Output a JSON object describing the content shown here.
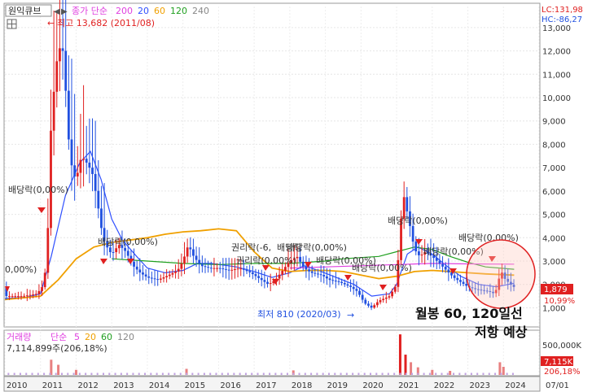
{
  "header": {
    "stock_name": "원익큐브",
    "legend_prefix": "종가 단순",
    "ma_periods": [
      "200",
      "20",
      "60",
      "120",
      "240"
    ],
    "ma_colors": [
      "#e040e0",
      "#3050ff",
      "#f0a000",
      "#20a020",
      "#888888"
    ],
    "lc": "LC:131,98",
    "hc": "HC:-86,27"
  },
  "annotations": {
    "high_label": "최고 13,682 (2011/08)",
    "low_label": "최저 810 (2020/03)",
    "dividend": "배당락(0,00%)",
    "dividend_trunc": "배당락",
    "rights": "권리락(-6,",
    "rights_combo": "권리락(0,00%)",
    "edge_pct": "0,00%)",
    "price_tag": "1,879",
    "pct_tag": "10,99%",
    "note_line1": "월봉 60, 120일선",
    "note_line2": "저항 예상"
  },
  "volume_panel": {
    "legend_prefix": "거래량",
    "legend_ma": "단순",
    "periods": [
      "5",
      "20",
      "60",
      "120"
    ],
    "period_colors": [
      "#e040e0",
      "#f0a000",
      "#20a020",
      "#888888"
    ],
    "summary": "7,114,899주(206,18%)",
    "axis_top": "500,000K",
    "vol_tag": "7,115K",
    "vol_pct": "206,18%"
  },
  "x_labels": [
    "2010",
    "2011",
    "2012",
    "2013",
    "2014",
    "2015",
    "2016",
    "2017",
    "2018",
    "2019",
    "2020",
    "2021",
    "2022",
    "2023",
    "2024",
    "07/01"
  ],
  "chart_data": {
    "type": "candlestick",
    "interval": "monthly",
    "y_ticks": [
      1000,
      2000,
      3000,
      4000,
      5000,
      6000,
      7000,
      8000,
      9000,
      10000,
      11000,
      12000,
      13000
    ],
    "y_tick_labels": [
      "1,000",
      "2,000",
      "3,000",
      "4,000",
      "5,000",
      "6,000",
      "7,000",
      "8,000",
      "9,000",
      "10,000",
      "11,000",
      "12,000",
      "13,000"
    ],
    "ylim": [
      250,
      13900
    ],
    "x_range": [
      2010.0,
      2025.0
    ],
    "points": [
      [
        2010.0,
        1500
      ],
      [
        2010.5,
        1500
      ],
      [
        2010.9,
        1600
      ],
      [
        2011.1,
        2000
      ],
      [
        2011.2,
        4000
      ],
      [
        2011.3,
        9000
      ],
      [
        2011.45,
        11500
      ],
      [
        2011.6,
        12500
      ],
      [
        2011.7,
        10500
      ],
      [
        2011.8,
        8000
      ],
      [
        2011.9,
        6800
      ],
      [
        2012.0,
        6500
      ],
      [
        2012.15,
        7500
      ],
      [
        2012.3,
        7200
      ],
      [
        2012.45,
        6800
      ],
      [
        2012.6,
        5500
      ],
      [
        2012.75,
        4000
      ],
      [
        2012.9,
        3500
      ],
      [
        2013.0,
        3300
      ],
      [
        2013.2,
        3700
      ],
      [
        2013.4,
        3400
      ],
      [
        2013.6,
        2800
      ],
      [
        2013.8,
        2500
      ],
      [
        2014.0,
        2300
      ],
      [
        2014.3,
        2200
      ],
      [
        2014.6,
        2400
      ],
      [
        2014.85,
        2600
      ],
      [
        2015.0,
        3000
      ],
      [
        2015.15,
        3700
      ],
      [
        2015.3,
        3200
      ],
      [
        2015.5,
        2800
      ],
      [
        2015.75,
        2700
      ],
      [
        2016.0,
        2700
      ],
      [
        2016.3,
        2600
      ],
      [
        2016.6,
        2700
      ],
      [
        2016.9,
        2500
      ],
      [
        2017.1,
        2300
      ],
      [
        2017.4,
        2000
      ],
      [
        2017.6,
        2200
      ],
      [
        2017.8,
        2600
      ],
      [
        2018.0,
        3000
      ],
      [
        2018.2,
        3200
      ],
      [
        2018.4,
        2700
      ],
      [
        2018.6,
        2500
      ],
      [
        2018.9,
        2400
      ],
      [
        2019.1,
        2200
      ],
      [
        2019.4,
        2100
      ],
      [
        2019.7,
        1900
      ],
      [
        2019.9,
        1700
      ],
      [
        2020.1,
        1200
      ],
      [
        2020.3,
        1000
      ],
      [
        2020.5,
        1300
      ],
      [
        2020.8,
        1500
      ],
      [
        2021.0,
        2000
      ],
      [
        2021.1,
        4500
      ],
      [
        2021.2,
        5800
      ],
      [
        2021.35,
        4700
      ],
      [
        2021.5,
        3500
      ],
      [
        2021.65,
        3200
      ],
      [
        2021.8,
        3400
      ],
      [
        2022.0,
        3200
      ],
      [
        2022.2,
        2900
      ],
      [
        2022.4,
        2600
      ],
      [
        2022.6,
        2300
      ],
      [
        2022.8,
        2100
      ],
      [
        2023.0,
        1900
      ],
      [
        2023.2,
        1800
      ],
      [
        2023.4,
        1750
      ],
      [
        2023.6,
        1700
      ],
      [
        2023.75,
        1600
      ],
      [
        2023.85,
        2000
      ],
      [
        2023.92,
        2700
      ],
      [
        2024.0,
        2300
      ],
      [
        2024.2,
        2000
      ],
      [
        2024.3,
        1879
      ]
    ],
    "moving_averages": [
      {
        "name": "20",
        "color": "#3050ff",
        "values": [
          [
            2010.0,
            1400
          ],
          [
            2010.6,
            1450
          ],
          [
            2011.0,
            1600
          ],
          [
            2011.3,
            3200
          ],
          [
            2011.7,
            5800
          ],
          [
            2012.1,
            7200
          ],
          [
            2012.4,
            7700
          ],
          [
            2012.7,
            6500
          ],
          [
            2013.0,
            4800
          ],
          [
            2013.3,
            3900
          ],
          [
            2013.7,
            3200
          ],
          [
            2014.0,
            2700
          ],
          [
            2014.5,
            2500
          ],
          [
            2015.0,
            2600
          ],
          [
            2015.4,
            2900
          ],
          [
            2015.8,
            2900
          ],
          [
            2016.5,
            2750
          ],
          [
            2017.0,
            2550
          ],
          [
            2017.5,
            2300
          ],
          [
            2018.0,
            2500
          ],
          [
            2018.4,
            2800
          ],
          [
            2018.8,
            2600
          ],
          [
            2019.3,
            2300
          ],
          [
            2019.8,
            2000
          ],
          [
            2020.3,
            1500
          ],
          [
            2020.8,
            1600
          ],
          [
            2021.0,
            2000
          ],
          [
            2021.3,
            3300
          ],
          [
            2021.6,
            3600
          ],
          [
            2022.0,
            3300
          ],
          [
            2022.4,
            2800
          ],
          [
            2022.8,
            2350
          ],
          [
            2023.3,
            2000
          ],
          [
            2023.8,
            1900
          ],
          [
            2024.3,
            2050
          ]
        ]
      },
      {
        "name": "60",
        "color": "#f0a000",
        "values": [
          [
            2010.0,
            1350
          ],
          [
            2011.0,
            1500
          ],
          [
            2011.5,
            2200
          ],
          [
            2012.0,
            3100
          ],
          [
            2012.5,
            3600
          ],
          [
            2013.0,
            3800
          ],
          [
            2013.5,
            3900
          ],
          [
            2014.0,
            4000
          ],
          [
            2014.5,
            4150
          ],
          [
            2015.0,
            4250
          ],
          [
            2015.5,
            4300
          ],
          [
            2016.0,
            4380
          ],
          [
            2016.5,
            4300
          ],
          [
            2017.0,
            3400
          ],
          [
            2017.5,
            2700
          ],
          [
            2018.0,
            2550
          ],
          [
            2018.5,
            2600
          ],
          [
            2019.0,
            2600
          ],
          [
            2019.5,
            2550
          ],
          [
            2020.0,
            2400
          ],
          [
            2020.5,
            2250
          ],
          [
            2021.0,
            2350
          ],
          [
            2021.5,
            2550
          ],
          [
            2022.0,
            2600
          ],
          [
            2022.5,
            2550
          ],
          [
            2023.0,
            2500
          ],
          [
            2023.5,
            2450
          ],
          [
            2024.3,
            2400
          ]
        ]
      },
      {
        "name": "120",
        "color": "#20a020",
        "values": [
          [
            2013.0,
            3100
          ],
          [
            2014.0,
            3000
          ],
          [
            2015.0,
            2900
          ],
          [
            2016.0,
            2850
          ],
          [
            2017.0,
            2900
          ],
          [
            2018.0,
            2900
          ],
          [
            2019.0,
            3000
          ],
          [
            2019.5,
            3100
          ],
          [
            2020.0,
            3150
          ],
          [
            2020.5,
            3200
          ],
          [
            2021.0,
            3400
          ],
          [
            2021.5,
            3600
          ],
          [
            2022.0,
            3500
          ],
          [
            2022.5,
            3200
          ],
          [
            2023.0,
            2950
          ],
          [
            2023.5,
            2750
          ],
          [
            2024.3,
            2650
          ]
        ]
      },
      {
        "name": "200",
        "color": "#e040e0",
        "values": [
          [
            2018.0,
            2700
          ],
          [
            2019.0,
            2750
          ],
          [
            2020.0,
            2800
          ],
          [
            2021.0,
            2850
          ],
          [
            2022.0,
            2900
          ],
          [
            2023.0,
            2880
          ],
          [
            2024.3,
            2870
          ]
        ]
      }
    ],
    "volume": [
      [
        2011.3,
        3.0
      ],
      [
        2011.5,
        2.0
      ],
      [
        2012.0,
        1.0
      ],
      [
        2015.1,
        1.2
      ],
      [
        2018.1,
        0.9
      ],
      [
        2021.1,
        8.0
      ],
      [
        2021.25,
        4.0
      ],
      [
        2021.4,
        2.5
      ],
      [
        2021.6,
        1.5
      ],
      [
        2022.0,
        1.0
      ],
      [
        2022.5,
        0.8
      ],
      [
        2023.9,
        2.5
      ],
      [
        2024.0,
        1.6
      ]
    ]
  }
}
